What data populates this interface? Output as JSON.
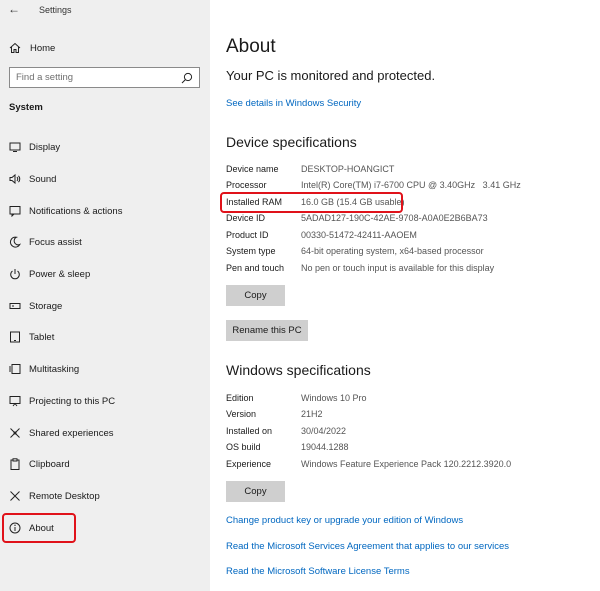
{
  "window": {
    "title": "Settings",
    "back_glyph": "←"
  },
  "sidebar": {
    "home_label": "Home",
    "search_placeholder": "Find a setting",
    "section_label": "System",
    "items": [
      {
        "label": "Display",
        "icon": "display-icon"
      },
      {
        "label": "Sound",
        "icon": "sound-icon"
      },
      {
        "label": "Notifications & actions",
        "icon": "notifications-icon"
      },
      {
        "label": "Focus assist",
        "icon": "focus-assist-icon"
      },
      {
        "label": "Power & sleep",
        "icon": "power-icon"
      },
      {
        "label": "Storage",
        "icon": "storage-icon"
      },
      {
        "label": "Tablet",
        "icon": "tablet-icon"
      },
      {
        "label": "Multitasking",
        "icon": "multitasking-icon"
      },
      {
        "label": "Projecting to this PC",
        "icon": "projecting-icon"
      },
      {
        "label": "Shared experiences",
        "icon": "shared-experiences-icon"
      },
      {
        "label": "Clipboard",
        "icon": "clipboard-icon"
      },
      {
        "label": "Remote Desktop",
        "icon": "remote-desktop-icon"
      },
      {
        "label": "About",
        "icon": "info-icon",
        "selected": true
      }
    ]
  },
  "main": {
    "title": "About",
    "protection_status": "Your PC is monitored and protected.",
    "security_link": "See details in Windows Security",
    "device_specs": {
      "heading": "Device specifications",
      "rows": [
        {
          "key": "Device name",
          "value": "DESKTOP-HOANGICT"
        },
        {
          "key": "Processor",
          "value": "Intel(R) Core(TM) i7-6700 CPU @ 3.40GHz   3.41 GHz"
        },
        {
          "key": "Installed RAM",
          "value": "16.0 GB (15.4 GB usable)"
        },
        {
          "key": "Device ID",
          "value": "5ADAD127-190C-42AE-9708-A0A0E2B6BA73"
        },
        {
          "key": "Product ID",
          "value": "00330-51472-42411-AAOEM"
        },
        {
          "key": "System type",
          "value": "64-bit operating system, x64-based processor"
        },
        {
          "key": "Pen and touch",
          "value": "No pen or touch input is available for this display"
        }
      ],
      "copy_label": "Copy",
      "rename_label": "Rename this PC"
    },
    "windows_specs": {
      "heading": "Windows specifications",
      "rows": [
        {
          "key": "Edition",
          "value": "Windows 10 Pro"
        },
        {
          "key": "Version",
          "value": "21H2"
        },
        {
          "key": "Installed on",
          "value": "30/04/2022"
        },
        {
          "key": "OS build",
          "value": "19044.1288"
        },
        {
          "key": "Experience",
          "value": "Windows Feature Experience Pack 120.2212.3920.0"
        }
      ],
      "copy_label": "Copy"
    },
    "links": [
      "Change product key or upgrade your edition of Windows",
      "Read the Microsoft Services Agreement that applies to our services",
      "Read the Microsoft Software License Terms"
    ],
    "highlight_color": "#e0121a",
    "link_color": "#0067c0"
  }
}
